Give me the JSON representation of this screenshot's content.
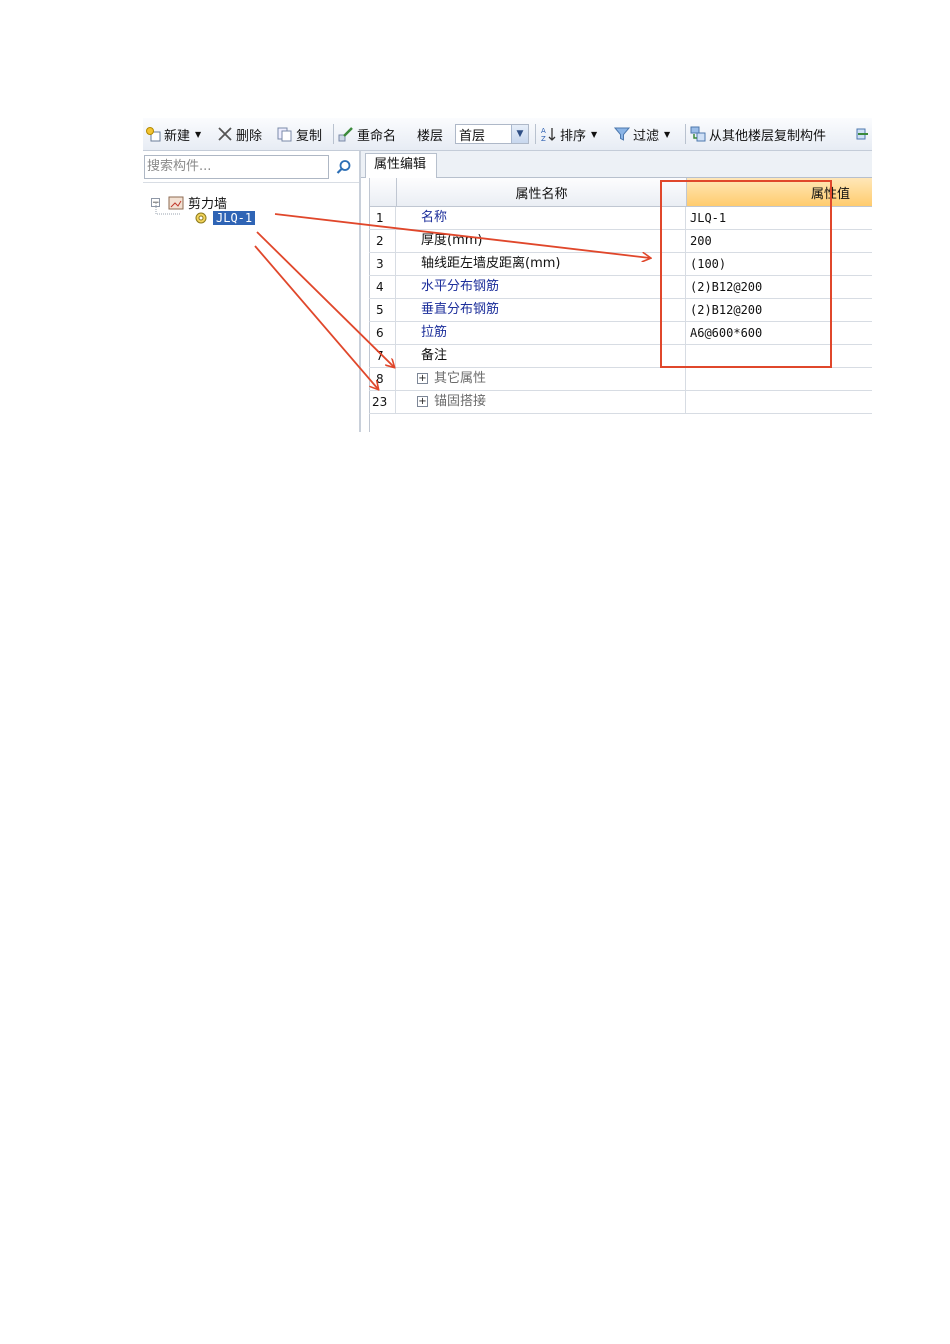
{
  "toolbar": {
    "items": [
      {
        "label": "新建",
        "icon": "new-icon",
        "dropdown": true
      },
      {
        "label": "删除",
        "icon": "delete-icon",
        "dropdown": false
      },
      {
        "label": "复制",
        "icon": "copy-icon",
        "dropdown": false
      },
      {
        "label": "重命名",
        "icon": "rename-icon",
        "dropdown": false
      }
    ],
    "floor_label": "楼层",
    "floor_value": "首层",
    "sort_label": "排序",
    "filter_label": "过滤",
    "copy_from_floor_label": "从其他楼层复制构件"
  },
  "left_panel": {
    "search_placeholder": "搜索构件...",
    "tree": {
      "root_label": "剪力墙",
      "child_label": "JLQ-1"
    }
  },
  "right_panel": {
    "tab_label": "属性编辑",
    "columns": [
      "属性名称",
      "属性值"
    ],
    "rows": [
      {
        "no": "1",
        "name": "名称",
        "value": "JLQ-1",
        "style": "blue"
      },
      {
        "no": "2",
        "name": "厚度(mm)",
        "value": "200",
        "style": "normal"
      },
      {
        "no": "3",
        "name": "轴线距左墙皮距离(mm)",
        "value": "(100)",
        "style": "normal"
      },
      {
        "no": "4",
        "name": "水平分布钢筋",
        "value": "(2)B12@200",
        "style": "blue"
      },
      {
        "no": "5",
        "name": "垂直分布钢筋",
        "value": "(2)B12@200",
        "style": "blue"
      },
      {
        "no": "6",
        "name": "拉筋",
        "value": "A6@600*600",
        "style": "blue"
      },
      {
        "no": "7",
        "name": "备注",
        "value": "",
        "style": "normal"
      }
    ],
    "groups": [
      {
        "no": "8",
        "name": "其它属性"
      },
      {
        "no": "23",
        "name": "锚固搭接"
      }
    ]
  },
  "colors": {
    "annotation_red": "#e0472b",
    "selection_blue": "#2f64b5",
    "header_highlight": "#ffcc6e",
    "property_blue_text": "#1d2f9b"
  }
}
